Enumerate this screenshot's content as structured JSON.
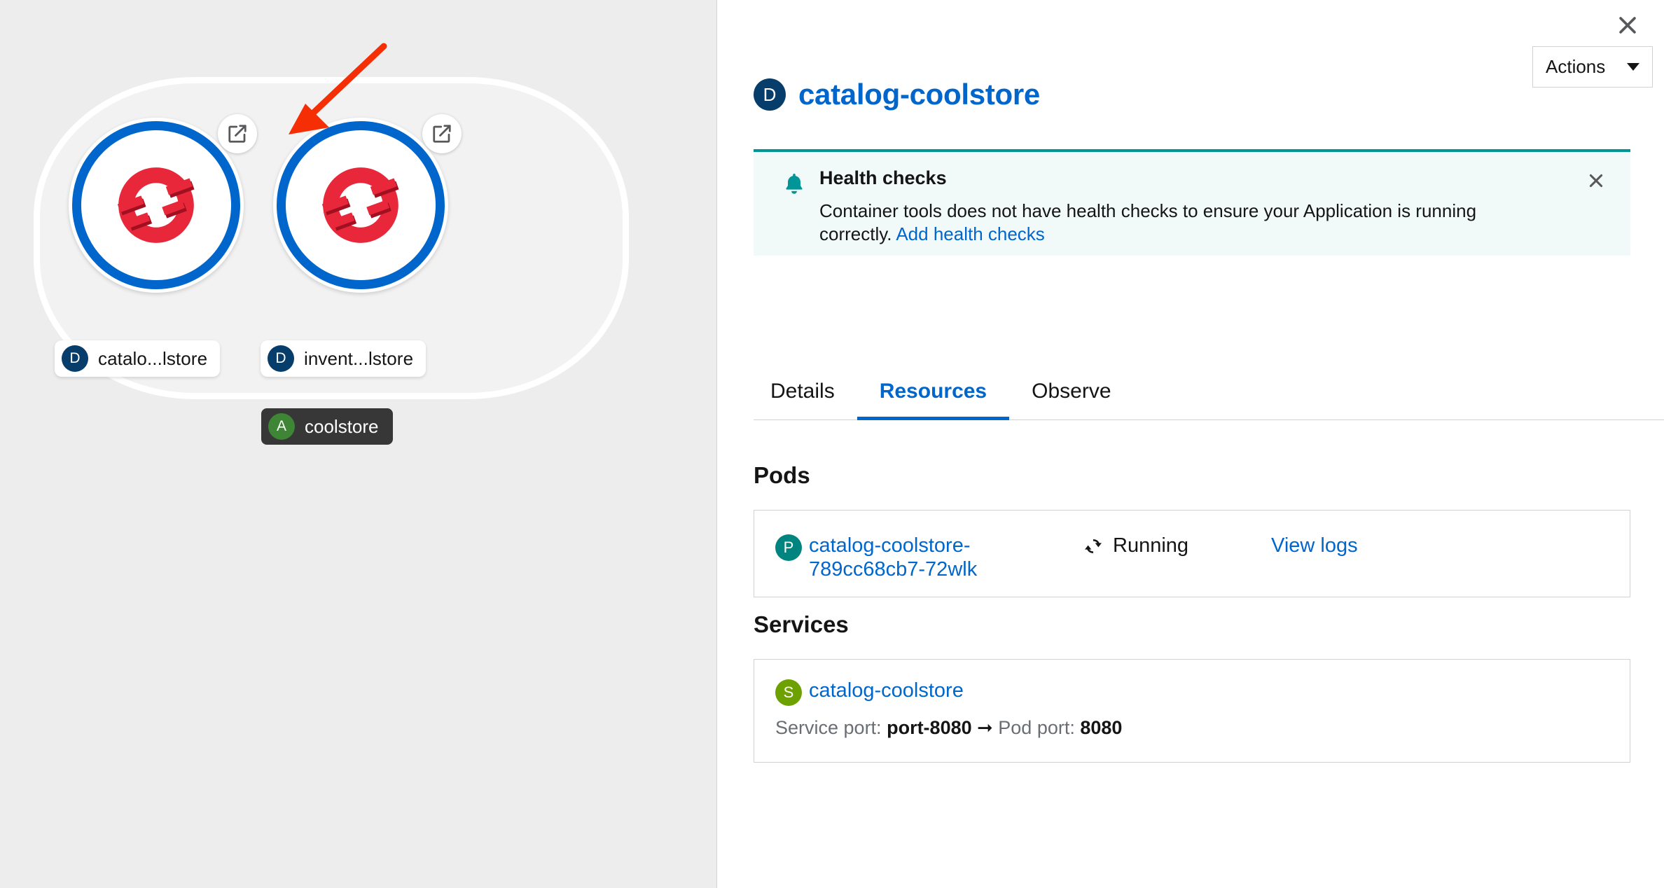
{
  "topology": {
    "group": {
      "label": "coolstore",
      "badge_letter": "A",
      "badge_color": "#3e8635"
    },
    "nodes": [
      {
        "label": "catalo...lstore",
        "badge_letter": "D",
        "badge_color": "#073d6b",
        "icon": "openshift-logo-icon",
        "action_icon": "external-link-icon"
      },
      {
        "label": "invent...lstore",
        "badge_letter": "D",
        "badge_color": "#073d6b",
        "icon": "openshift-logo-icon",
        "action_icon": "external-link-icon"
      }
    ],
    "annotation": {
      "type": "red-arrow",
      "color": "#f52e06"
    }
  },
  "panel": {
    "close_icon": "close-icon",
    "header": {
      "badge_letter": "D",
      "title": "catalog-coolstore",
      "title_color": "#0066cc"
    },
    "actions": {
      "label": "Actions",
      "caret_icon": "chevron-down-icon"
    },
    "alert": {
      "icon": "bell-icon",
      "accent_color": "#009596",
      "background": "#f2f9f9",
      "title": "Health checks",
      "body": "Container tools does not have health checks to ensure your Application is running correctly. ",
      "link": "Add health checks",
      "close_icon": "close-icon"
    },
    "tabs": [
      {
        "label": "Details",
        "active": false
      },
      {
        "label": "Resources",
        "active": true
      },
      {
        "label": "Observe",
        "active": false
      }
    ],
    "sections": [
      {
        "key": "pods",
        "title": "Pods",
        "rows": [
          {
            "badge_letter": "P",
            "badge_color": "#00847f",
            "name": "catalog-coolstore-789cc68cb7-72wlk",
            "status": "Running",
            "status_icon": "sync-icon",
            "action": "View logs"
          }
        ]
      },
      {
        "key": "services",
        "title": "Services",
        "rows": [
          {
            "badge_letter": "S",
            "badge_color": "#6ca100",
            "name": "catalog-coolstore",
            "service_port_label": "Service port:",
            "service_port": "port-8080",
            "arrow_icon": "arrow-right-icon",
            "pod_port_label": "Pod port:",
            "pod_port": "8080"
          }
        ]
      }
    ]
  }
}
